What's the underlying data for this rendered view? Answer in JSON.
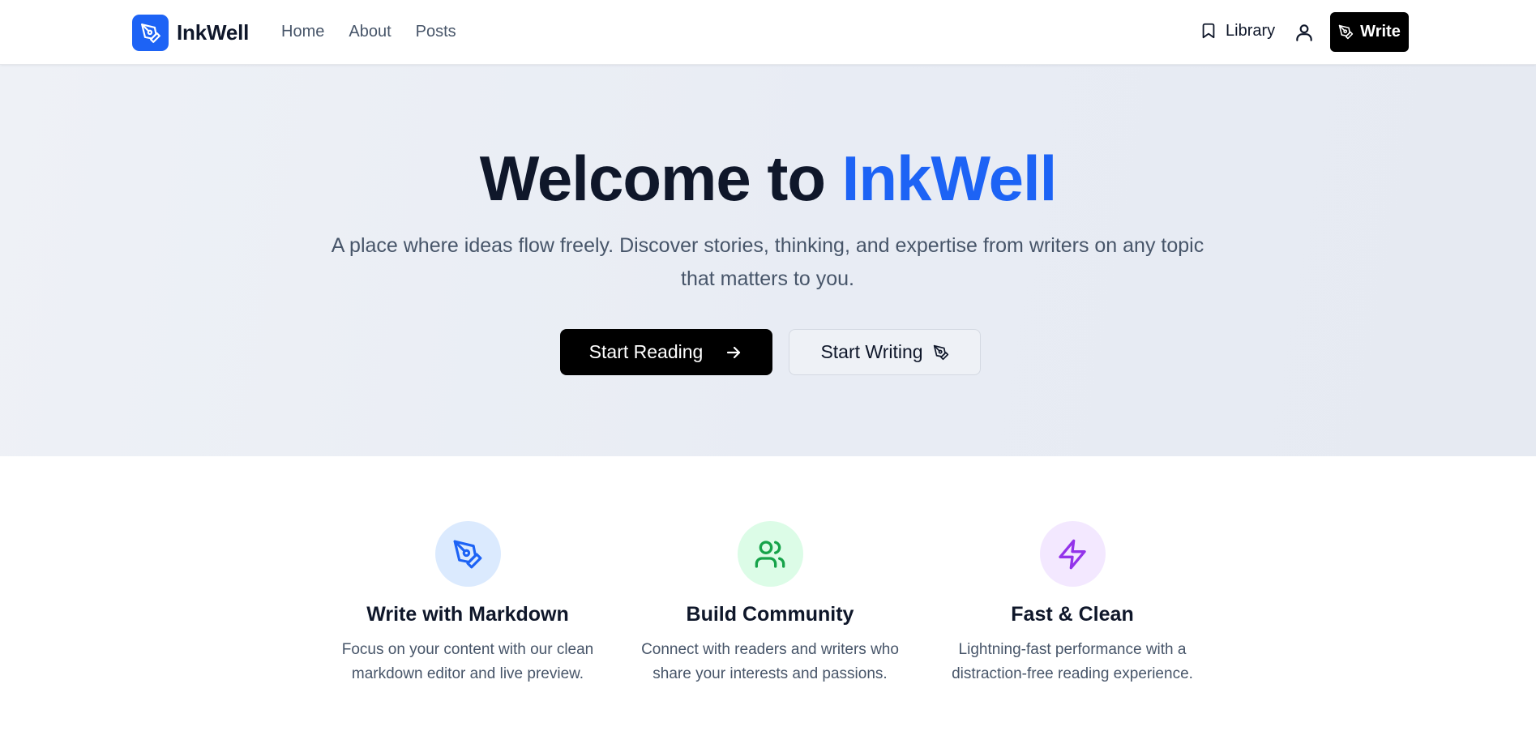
{
  "header": {
    "brand": "InkWell",
    "nav": [
      "Home",
      "About",
      "Posts"
    ],
    "library_label": "Library",
    "write_label": "Write"
  },
  "hero": {
    "title_prefix": "Welcome to",
    "title_accent": "InkWell",
    "subtitle": "A place where ideas flow freely. Discover stories, thinking, and expertise from writers on any topic that matters to you.",
    "primary_button": "Start Reading",
    "secondary_button": "Start Writing"
  },
  "features": [
    {
      "title": "Write with Markdown",
      "description": "Focus on your content with our clean markdown editor and live preview.",
      "icon": "pen-nib-icon",
      "color": "#1d63f5",
      "bg": "#dbeafe"
    },
    {
      "title": "Build Community",
      "description": "Connect with readers and writers who share your interests and passions.",
      "icon": "users-icon",
      "color": "#16a34a",
      "bg": "#dcfce7"
    },
    {
      "title": "Fast & Clean",
      "description": "Lightning-fast performance with a distraction-free reading experience.",
      "icon": "lightning-icon",
      "color": "#9333ea",
      "bg": "#f3e8ff"
    }
  ],
  "colors": {
    "accent": "#1d63f5",
    "text": "#0f172a",
    "muted": "#475569"
  }
}
